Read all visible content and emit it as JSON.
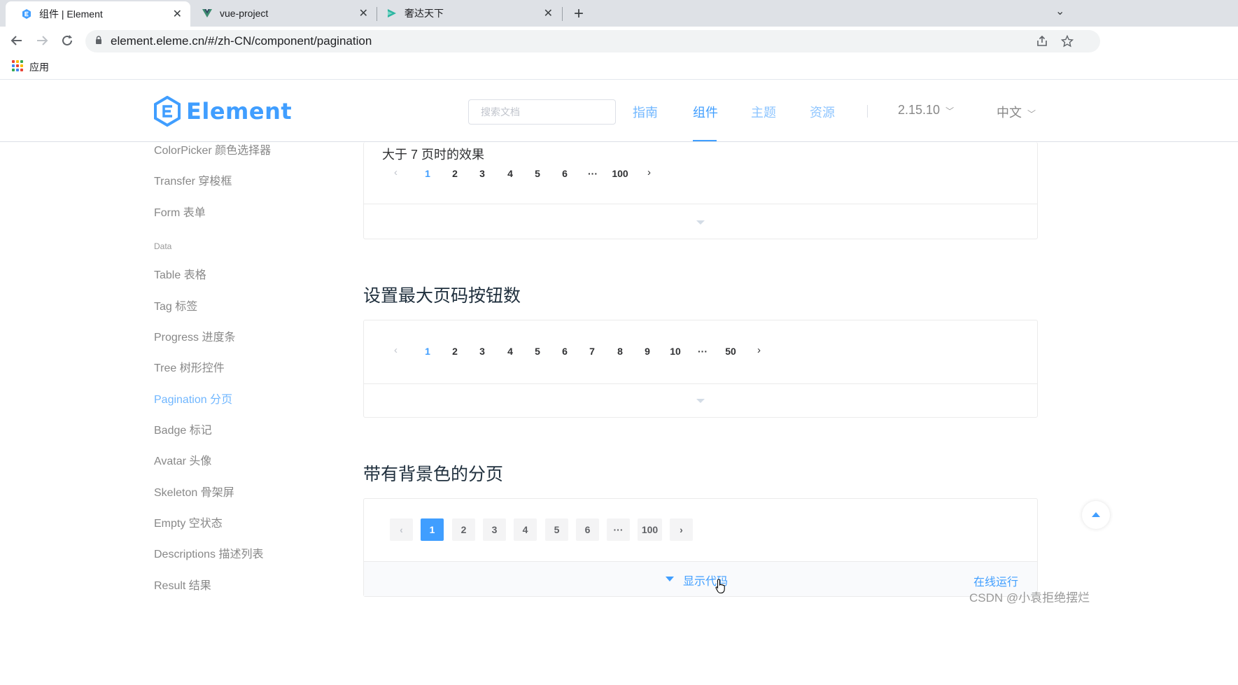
{
  "browser": {
    "tabs": [
      {
        "title": "组件 | Element",
        "icon": "element-favicon",
        "active": true
      },
      {
        "title": "vue-project",
        "icon": "vue-favicon",
        "active": false
      },
      {
        "title": "奢达天下",
        "icon": "generic-favicon",
        "active": false
      }
    ],
    "close_glyph": "✕",
    "new_tab_glyph": "+",
    "tab_menu_glyph": "⌄",
    "url": "element.eleme.cn/#/zh-CN/component/pagination",
    "bookmarks": {
      "apps_label": "应用"
    }
  },
  "site": {
    "logo_text": "Element",
    "search_placeholder": "搜索文档",
    "nav": {
      "guide": "指南",
      "component": "组件",
      "theme": "主题",
      "resource": "资源",
      "version": "2.15.10",
      "language": "中文"
    },
    "brand_color": "#409eff"
  },
  "sidebar": {
    "items_top": [
      "ColorPicker 颜色选择器",
      "Transfer 穿梭框",
      "Form 表单"
    ],
    "group_label": "Data",
    "items_data": [
      "Table 表格",
      "Tag 标签",
      "Progress 进度条",
      "Tree 树形控件",
      "Pagination 分页",
      "Badge 标记",
      "Avatar 头像",
      "Skeleton 骨架屏",
      "Empty 空状态",
      "Descriptions 描述列表",
      "Result 结果"
    ],
    "active_item": "Pagination 分页"
  },
  "main": {
    "demo1": {
      "label": "大于 7 页时的效果",
      "pages": [
        "1",
        "2",
        "3",
        "4",
        "5",
        "6",
        "···",
        "100"
      ],
      "current": "1"
    },
    "section2": {
      "title": "设置最大页码按钮数",
      "pages": [
        "1",
        "2",
        "3",
        "4",
        "5",
        "6",
        "7",
        "8",
        "9",
        "10",
        "···",
        "50"
      ],
      "current": "1"
    },
    "section3": {
      "title": "带有背景色的分页",
      "pages": [
        "1",
        "2",
        "3",
        "4",
        "5",
        "6",
        "···",
        "100"
      ],
      "current": "1",
      "show_code": "显示代码",
      "run_online": "在线运行"
    },
    "prev_glyph": "‹",
    "next_glyph": "›"
  },
  "watermark": "CSDN @小袁拒绝摆烂"
}
